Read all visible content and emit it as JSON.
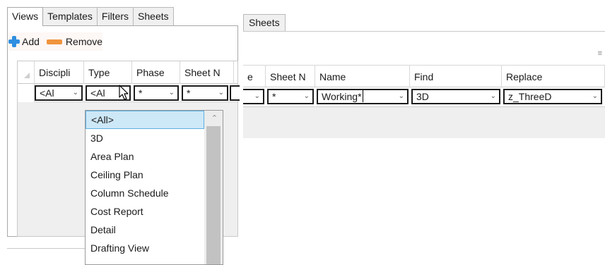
{
  "left": {
    "tabs": [
      "Views",
      "Templates",
      "Filters",
      "Sheets"
    ],
    "toolbar": {
      "add_label": "Add",
      "remove_label": "Remove"
    },
    "columns": [
      "Discipli",
      "Type",
      "Phase",
      "Sheet N"
    ],
    "row": {
      "discipline": "<Al",
      "type": "<Al",
      "phase": "*",
      "sheet_number": "*"
    },
    "dropdown": {
      "selected": "<All>",
      "options": [
        "<All>",
        "3D",
        "Area Plan",
        "Ceiling Plan",
        "Column Schedule",
        "Cost Report",
        "Detail",
        "Drafting View"
      ]
    }
  },
  "right": {
    "tab": "Sheets",
    "columns": [
      "e",
      "Sheet N",
      "Name",
      "Find",
      "Replace"
    ],
    "row": {
      "sheet_number": "*",
      "name": "Working*",
      "find": "3D",
      "replace": "z_ThreeD"
    }
  },
  "icons": {
    "add": "plus-icon",
    "remove": "minus-icon",
    "dropdown": "chevron-down-icon",
    "cursor": "mouse-pointer-icon"
  }
}
